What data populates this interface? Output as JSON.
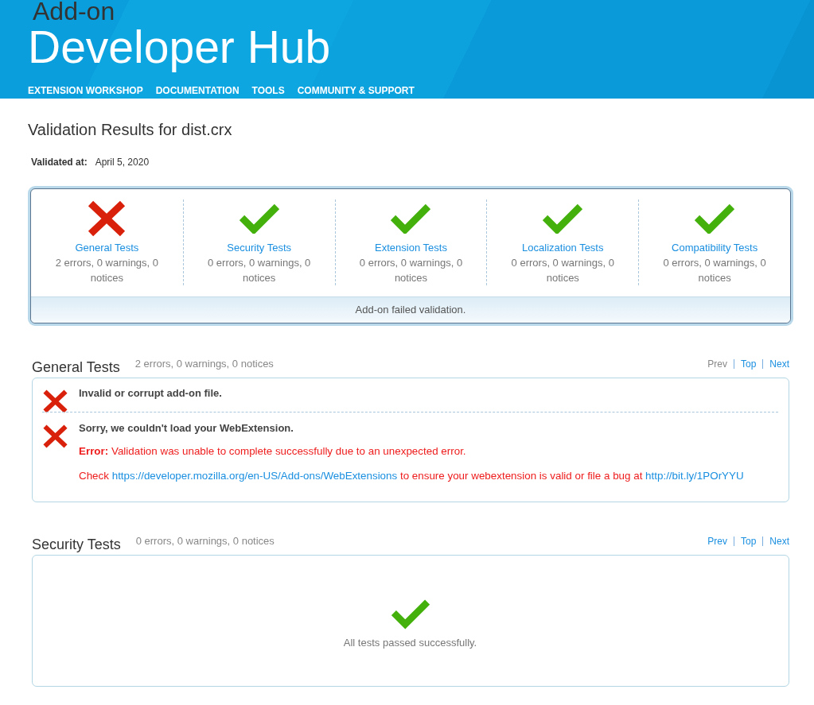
{
  "header": {
    "overline": "Add-on",
    "title": "Developer Hub",
    "nav": [
      "EXTENSION WORKSHOP",
      "DOCUMENTATION",
      "TOOLS",
      "COMMUNITY & SUPPORT"
    ]
  },
  "page": {
    "title": "Validation Results for dist.crx",
    "validated_label": "Validated at:",
    "validated_value": "April 5, 2020"
  },
  "summary": {
    "tests": [
      {
        "name": "General Tests",
        "passed": false,
        "counts": "2 errors, 0 warnings, 0 notices"
      },
      {
        "name": "Security Tests",
        "passed": true,
        "counts": "0 errors, 0 warnings, 0 notices"
      },
      {
        "name": "Extension Tests",
        "passed": true,
        "counts": "0 errors, 0 warnings, 0 notices"
      },
      {
        "name": "Localization Tests",
        "passed": true,
        "counts": "0 errors, 0 warnings, 0 notices"
      },
      {
        "name": "Compatibility Tests",
        "passed": true,
        "counts": "0 errors, 0 warnings, 0 notices"
      }
    ],
    "result": "Add-on failed validation."
  },
  "sections": [
    {
      "title": "General Tests",
      "counts": "2 errors, 0 warnings, 0 notices",
      "nav": [
        {
          "label": "Prev",
          "disabled": true
        },
        {
          "label": "Top",
          "disabled": false
        },
        {
          "label": "Next",
          "disabled": false
        }
      ],
      "messages": [
        {
          "kind": "error",
          "title": "Invalid or corrupt add-on file."
        },
        {
          "kind": "error",
          "title": "Sorry, we couldn't load your WebExtension.",
          "details": [
            [
              {
                "kind": "text",
                "text": "**Error:** Validation was unable to complete successfully due to an unexpected error."
              }
            ],
            [
              {
                "kind": "text",
                "text": "Check "
              },
              {
                "kind": "link",
                "text": "https://developer.mozilla.org/en-US/Add-ons/WebExtensions"
              },
              {
                "kind": "text",
                "text": " to ensure your webextension is valid or file a bug at "
              },
              {
                "kind": "link",
                "text": "http://bit.ly/1POrYYU"
              }
            ]
          ]
        }
      ]
    },
    {
      "title": "Security Tests",
      "counts": "0 errors, 0 warnings, 0 notices",
      "nav": [
        {
          "label": "Prev",
          "disabled": false
        },
        {
          "label": "Top",
          "disabled": false
        },
        {
          "label": "Next",
          "disabled": false
        }
      ],
      "pass_message": "All tests passed successfully."
    }
  ]
}
